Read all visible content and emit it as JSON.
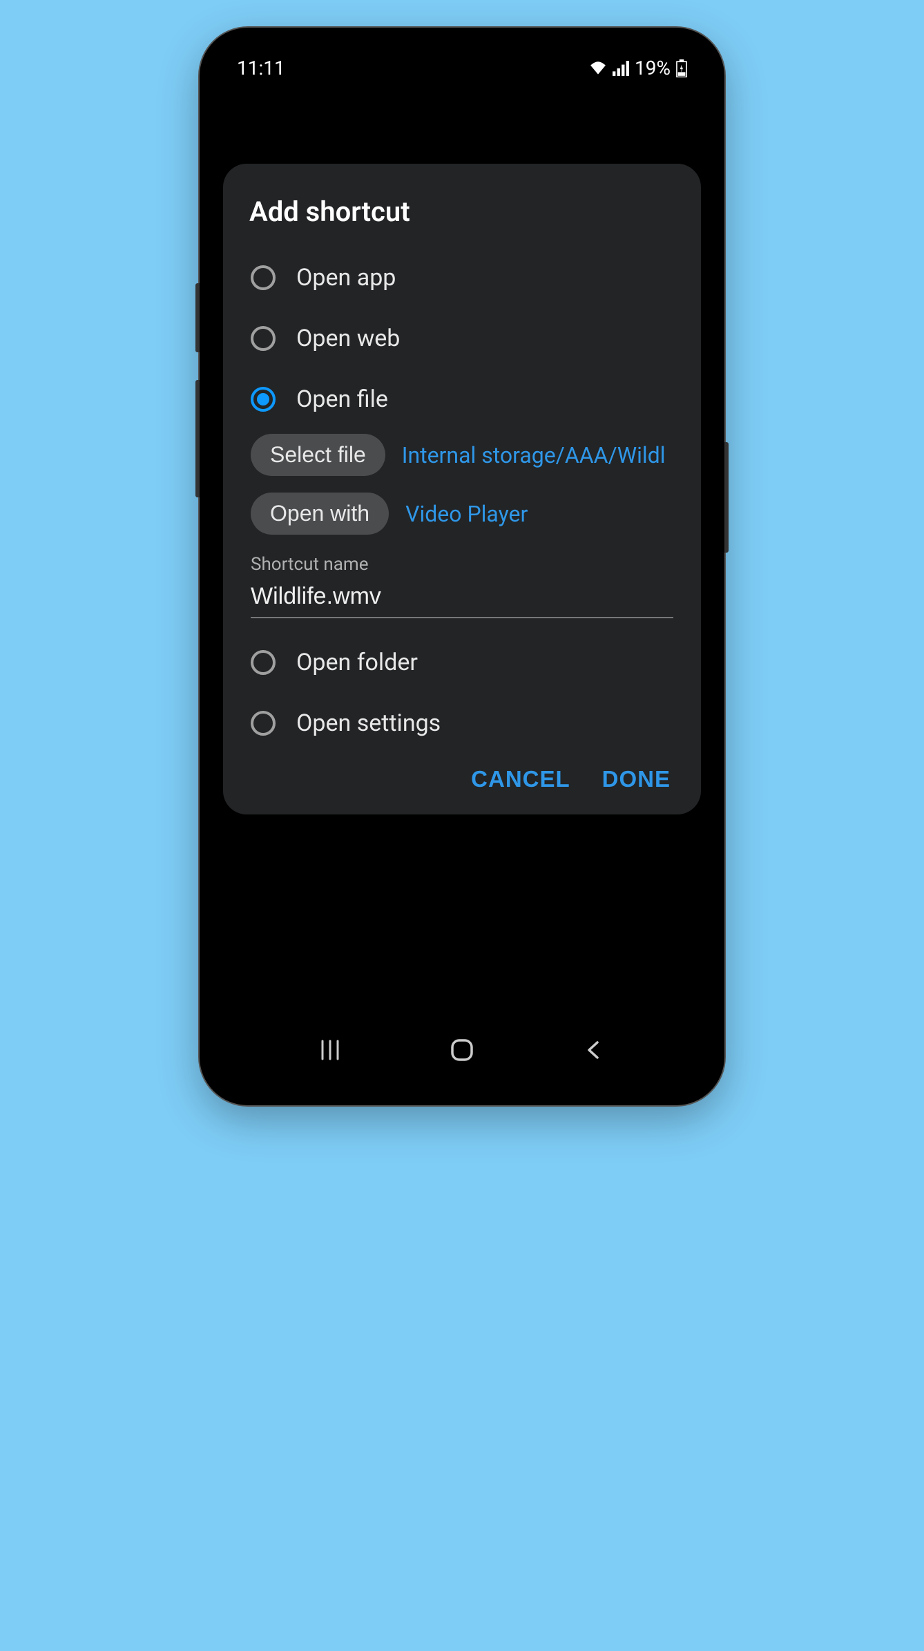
{
  "status": {
    "time": "11:11",
    "battery": "19%"
  },
  "dialog": {
    "title": "Add shortcut",
    "options": {
      "open_app": "Open app",
      "open_web": "Open web",
      "open_file": "Open file",
      "open_folder": "Open folder",
      "open_settings": "Open settings"
    },
    "select_file": {
      "button": "Select file",
      "value": "Internal storage/AAA/Wildl"
    },
    "open_with": {
      "button": "Open with",
      "value": "Video Player"
    },
    "shortcut_name": {
      "label": "Shortcut name",
      "value": "Wildlife.wmv"
    },
    "actions": {
      "cancel": "CANCEL",
      "done": "DONE"
    }
  }
}
